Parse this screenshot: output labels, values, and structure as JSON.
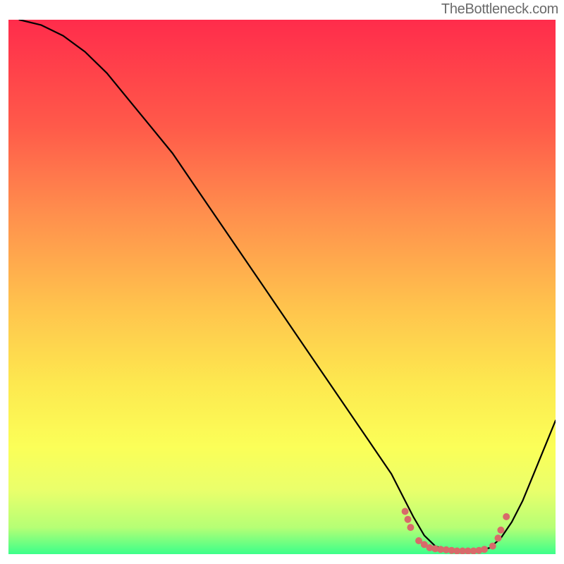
{
  "watermark": "TheBottleneck.com",
  "chart_data": {
    "type": "line",
    "title": "",
    "xlabel": "",
    "ylabel": "",
    "xlim": [
      0,
      100
    ],
    "ylim": [
      0,
      100
    ],
    "series": [
      {
        "name": "curve",
        "x": [
          2,
          6,
          10,
          14,
          18,
          22,
          26,
          30,
          34,
          38,
          42,
          46,
          50,
          54,
          58,
          62,
          66,
          70,
          72,
          74,
          76,
          78,
          80,
          82,
          84,
          86,
          88,
          90,
          92,
          94,
          96,
          98,
          100
        ],
        "values": [
          100,
          99,
          97,
          94,
          90,
          85,
          80,
          75,
          69,
          63,
          57,
          51,
          45,
          39,
          33,
          27,
          21,
          15,
          11,
          7,
          3.5,
          1.5,
          0.8,
          0.5,
          0.5,
          0.6,
          1.2,
          3,
          6,
          10,
          15,
          20,
          25
        ]
      }
    ],
    "markers": {
      "name": "dotted-band",
      "color": "#d86a6a",
      "points": [
        {
          "x": 72.5,
          "y": 8
        },
        {
          "x": 73.0,
          "y": 6.5
        },
        {
          "x": 73.5,
          "y": 5
        },
        {
          "x": 75,
          "y": 2.5
        },
        {
          "x": 76,
          "y": 1.8
        },
        {
          "x": 77,
          "y": 1.2
        },
        {
          "x": 78,
          "y": 1.0
        },
        {
          "x": 79,
          "y": 0.9
        },
        {
          "x": 80,
          "y": 0.8
        },
        {
          "x": 81,
          "y": 0.7
        },
        {
          "x": 82,
          "y": 0.6
        },
        {
          "x": 83,
          "y": 0.6
        },
        {
          "x": 84,
          "y": 0.6
        },
        {
          "x": 85,
          "y": 0.6
        },
        {
          "x": 86,
          "y": 0.7
        },
        {
          "x": 87,
          "y": 0.9
        },
        {
          "x": 88.5,
          "y": 1.5
        },
        {
          "x": 89.5,
          "y": 3
        },
        {
          "x": 90,
          "y": 4.5
        },
        {
          "x": 91,
          "y": 7
        }
      ]
    },
    "gradient_stops": [
      {
        "pos": 0,
        "color": "#ff2c4b"
      },
      {
        "pos": 20,
        "color": "#ff5a4a"
      },
      {
        "pos": 36,
        "color": "#ff8e4d"
      },
      {
        "pos": 54,
        "color": "#ffc44d"
      },
      {
        "pos": 68,
        "color": "#fde84f"
      },
      {
        "pos": 80,
        "color": "#fbff58"
      },
      {
        "pos": 88,
        "color": "#eaff6b"
      },
      {
        "pos": 95,
        "color": "#b6ff75"
      },
      {
        "pos": 100,
        "color": "#3bff8a"
      }
    ]
  }
}
